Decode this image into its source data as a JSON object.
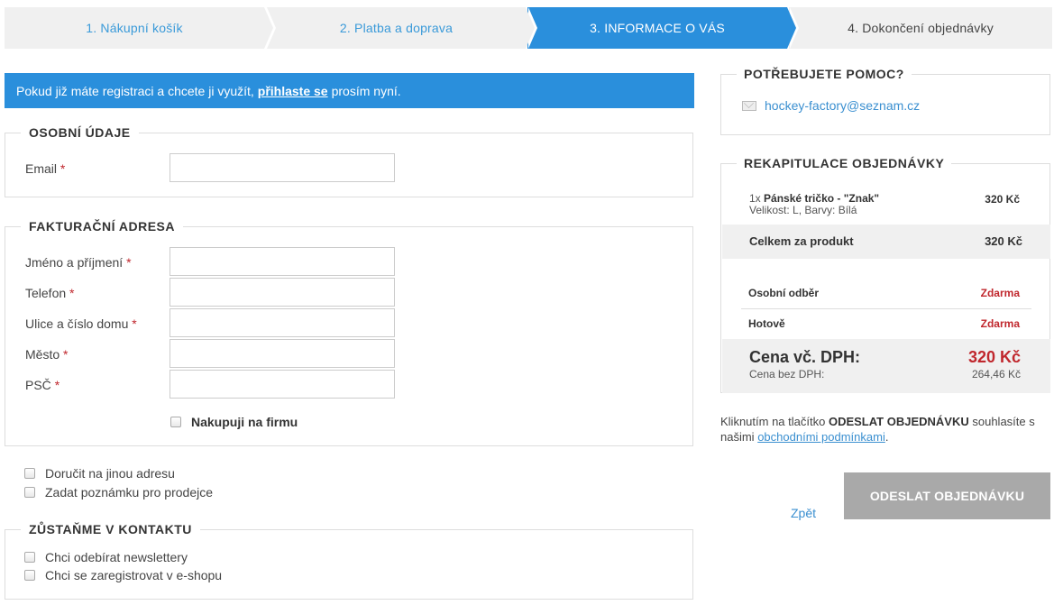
{
  "steps": [
    {
      "label": "1. Nákupní košík"
    },
    {
      "label": "2. Platba a doprava"
    },
    {
      "label": "3. INFORMACE O VÁS"
    },
    {
      "label": "4. Dokončení objednávky"
    }
  ],
  "banner": {
    "prefix": "Pokud již máte registraci a chcete ji využít,",
    "link": "přihlaste se",
    "suffix": "prosím nyní."
  },
  "personal": {
    "legend": "OSOBNÍ ÚDAJE",
    "email_label": "Email",
    "required_mark": "*"
  },
  "billing": {
    "legend": "FAKTURAČNÍ ADRESA",
    "fields": [
      {
        "label": "Jméno a příjmení"
      },
      {
        "label": "Telefon"
      },
      {
        "label": "Ulice a číslo domu"
      },
      {
        "label": "Město"
      },
      {
        "label": "PSČ"
      }
    ],
    "company_checkbox": "Nakupuji na firmu"
  },
  "options": {
    "other_address": "Doručit na jinou adresu",
    "note": "Zadat poznámku pro prodejce"
  },
  "contact": {
    "legend": "ZŮSTAŇME V KONTAKTU",
    "newsletter": "Chci odebírat newslettery",
    "register": "Chci se zaregistrovat v e-shopu"
  },
  "help": {
    "legend": "POTŘEBUJETE POMOC?",
    "email": "hockey-factory@seznam.cz"
  },
  "summary": {
    "legend": "REKAPITULACE OBJEDNÁVKY",
    "item_qty": "1x",
    "item_name": "Pánské tričko - \"Znak\"",
    "item_variant": "Velikost: L, Barvy: Bílá",
    "item_price": "320 Kč",
    "product_total_label": "Celkem za produkt",
    "product_total_value": "320 Kč",
    "shipping_label": "Osobní odběr",
    "shipping_value": "Zdarma",
    "payment_label": "Hotově",
    "payment_value": "Zdarma",
    "total_label": "Cena vč. DPH:",
    "total_value": "320 Kč",
    "total_novat_label": "Cena bez DPH:",
    "total_novat_value": "264,46 Kč"
  },
  "terms": {
    "text1": "Kliknutím na tlačítko",
    "button_ref": "ODESLAT OBJEDNÁVKU",
    "text2": "souhlasíte s našimi",
    "link": "obchodními podmínkami",
    "text3": "."
  },
  "actions": {
    "back": "Zpět",
    "submit": "ODESLAT OBJEDNÁVKU"
  },
  "colors": {
    "accent": "#2a8fdc",
    "price_red": "#c0272d",
    "submit_bg": "#a9a9a9"
  }
}
